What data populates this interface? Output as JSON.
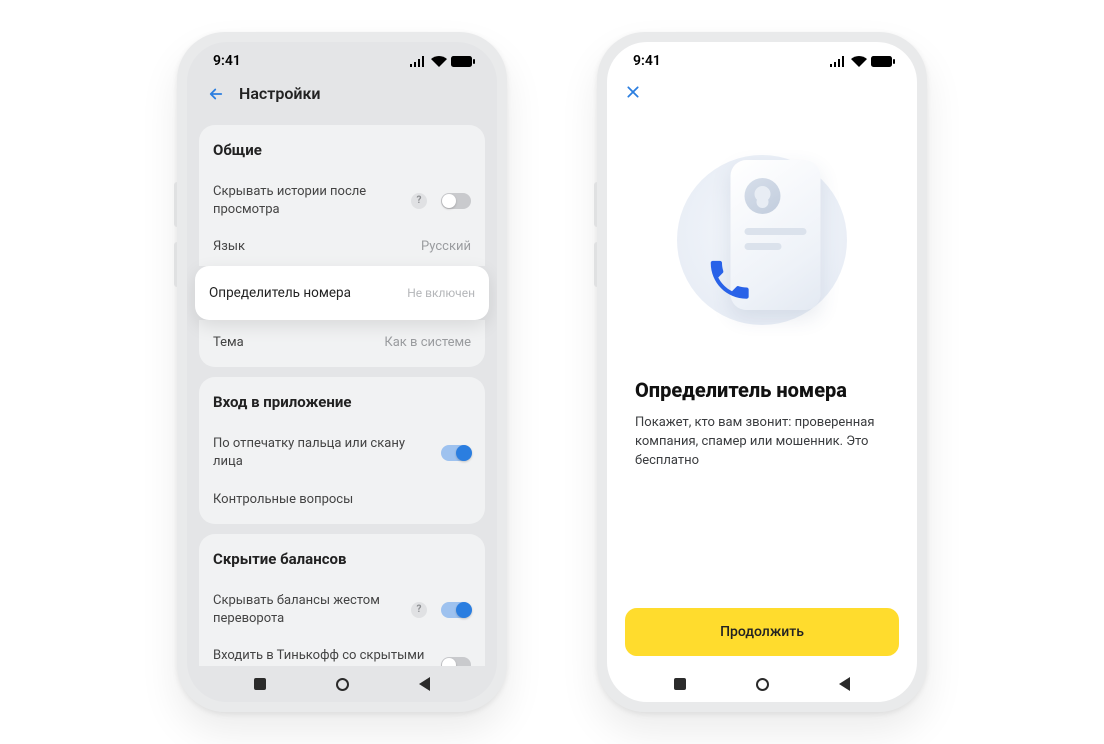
{
  "statusbar": {
    "time": "9:41"
  },
  "left": {
    "header": {
      "title": "Настройки"
    },
    "sections": {
      "general": {
        "title": "Общие",
        "hide_stories": "Скрывать истории после просмотра",
        "language_label": "Язык",
        "language_value": "Русский",
        "caller_id_label": "Определитель номера",
        "caller_id_value": "Не включен",
        "theme_label": "Тема",
        "theme_value": "Как в системе"
      },
      "login": {
        "title": "Вход в приложение",
        "biometric": "По отпечатку пальца или скану лица",
        "questions": "Контрольные вопросы"
      },
      "balance": {
        "title": "Скрытие балансов",
        "gesture": "Скрывать балансы жестом переворота",
        "hidden_login": "Входить в Тинькофф со скрытыми балансами"
      }
    }
  },
  "right": {
    "title": "Определитель номера",
    "text": "Покажет, кто вам звонит: проверенная компания, спамер или мошенник. Это бесплатно",
    "cta": "Продолжить"
  }
}
